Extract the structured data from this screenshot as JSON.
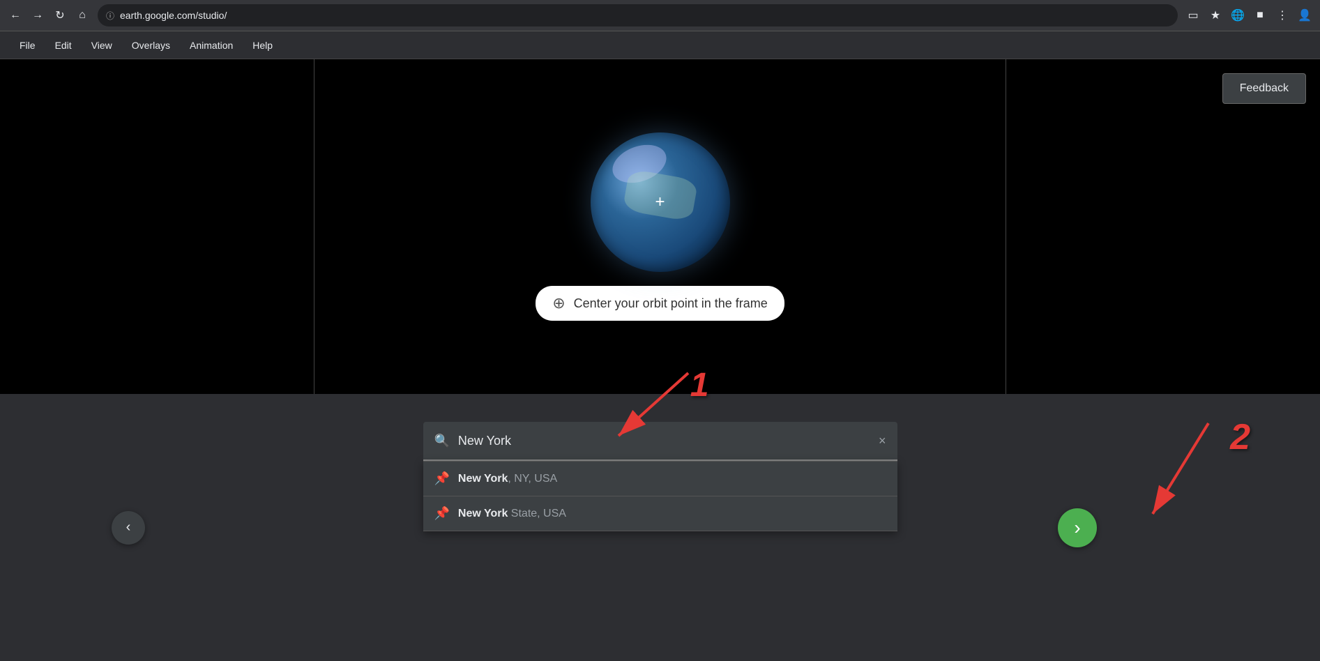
{
  "browser": {
    "url": "earth.google.com/studio/",
    "back_disabled": false,
    "forward_disabled": true
  },
  "menubar": {
    "items": [
      "File",
      "Edit",
      "View",
      "Overlays",
      "Animation",
      "Help"
    ]
  },
  "feedback_button": {
    "label": "Feedback"
  },
  "globe": {
    "crosshair": "+"
  },
  "orbit_tooltip": {
    "icon": "⊕",
    "text": "Center your orbit point in the frame"
  },
  "search": {
    "placeholder": "Search",
    "value": "New York",
    "clear_label": "×",
    "results": [
      {
        "bold": "New York",
        "rest": ", NY, USA"
      },
      {
        "bold": "New York",
        "rest": " State, USA"
      }
    ]
  },
  "back_button": {
    "label": "‹"
  },
  "forward_button": {
    "label": "›"
  },
  "annotations": {
    "num1": "1",
    "num2": "2"
  }
}
